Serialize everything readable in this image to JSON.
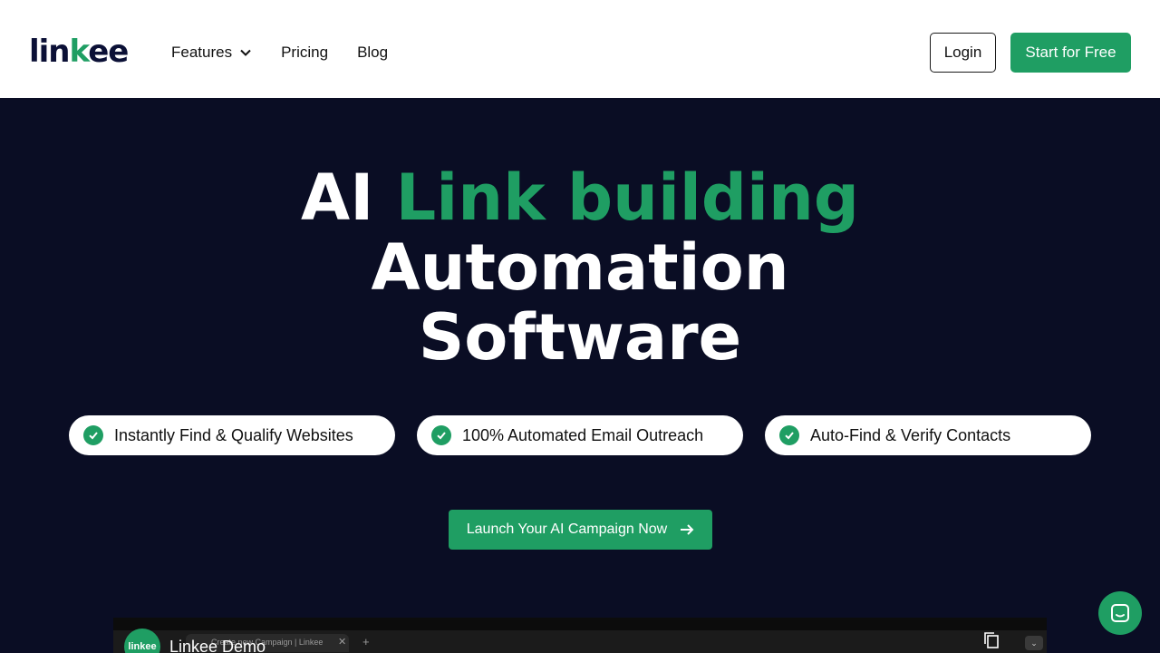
{
  "header": {
    "logo": {
      "prefix": "lin",
      "k": "k",
      "suffix": "ee"
    },
    "nav": [
      {
        "label": "Features",
        "dropdown": true
      },
      {
        "label": "Pricing"
      },
      {
        "label": "Blog"
      }
    ],
    "login_label": "Login",
    "start_label": "Start for Free"
  },
  "hero": {
    "title_plain": "AI",
    "title_highlight": "Link building",
    "title_line2": "Automation",
    "title_line3": "Software"
  },
  "features": [
    {
      "label": "Instantly Find & Qualify Websites",
      "icon": "check-icon"
    },
    {
      "label": "100% Automated Email Outreach",
      "icon": "check-icon"
    },
    {
      "label": "Auto-Find & Verify Contacts",
      "icon": "check-icon"
    }
  ],
  "cta": {
    "label": "Launch Your AI Campaign Now",
    "icon": "arrow-right-icon"
  },
  "video": {
    "channel_logo": "linkee",
    "title": "Linkee Demo",
    "tab_text": "Create new Campaign | Linkee",
    "icons": [
      "copy-icon",
      "chevron-down-icon"
    ]
  },
  "chat": {
    "icon": "chat-icon"
  },
  "colors": {
    "brand_green": "#1f9e63",
    "navy": "#0a0d24",
    "white": "#ffffff"
  }
}
